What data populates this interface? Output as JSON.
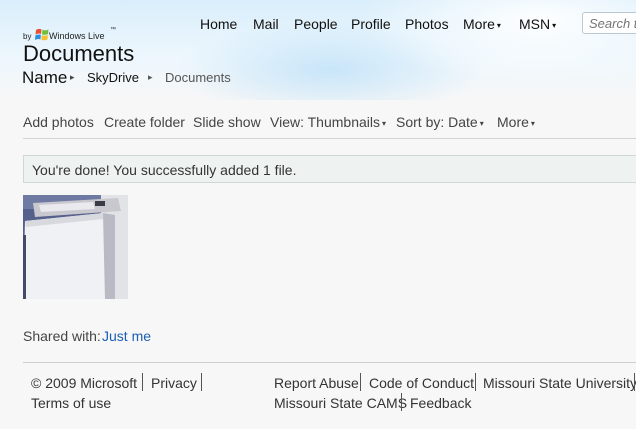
{
  "branding": {
    "by": "by",
    "live": "Windows Live",
    "tm": "™",
    "title": "Documents"
  },
  "breadcrumb": {
    "name": "Name",
    "skydrive": "SkyDrive",
    "documents": "Documents",
    "separator": "▸"
  },
  "nav": {
    "home": "Home",
    "mail": "Mail",
    "people": "People",
    "profile": "Profile",
    "photos": "Photos",
    "more": "More",
    "msn": "MSN",
    "caret": "▾"
  },
  "search": {
    "placeholder": "Search the web"
  },
  "commands": {
    "add_photos": "Add photos",
    "create_folder": "Create folder",
    "slide_show": "Slide show",
    "view": "View: Thumbnails",
    "sort": "Sort by: Date",
    "more": "More",
    "caret": "▾"
  },
  "notice": {
    "text": "You're done! You successfully added 1 file."
  },
  "shared": {
    "label": "Shared with:",
    "value": "Just me"
  },
  "footer": {
    "copyright": "© 2009 Microsoft",
    "privacy": "Privacy",
    "terms": "Terms of use",
    "report": "Report Abuse",
    "conduct": "Code of Conduct",
    "university": "Missouri State University",
    "cams": "Missouri State CAMS",
    "feedback": "Feedback"
  },
  "icons": {
    "windows_logo": "windows-flag-icon"
  },
  "colors": {
    "link": "#1a5fb4",
    "notice_bg": "#eef3f1",
    "header_sky": "#d9eefb"
  }
}
